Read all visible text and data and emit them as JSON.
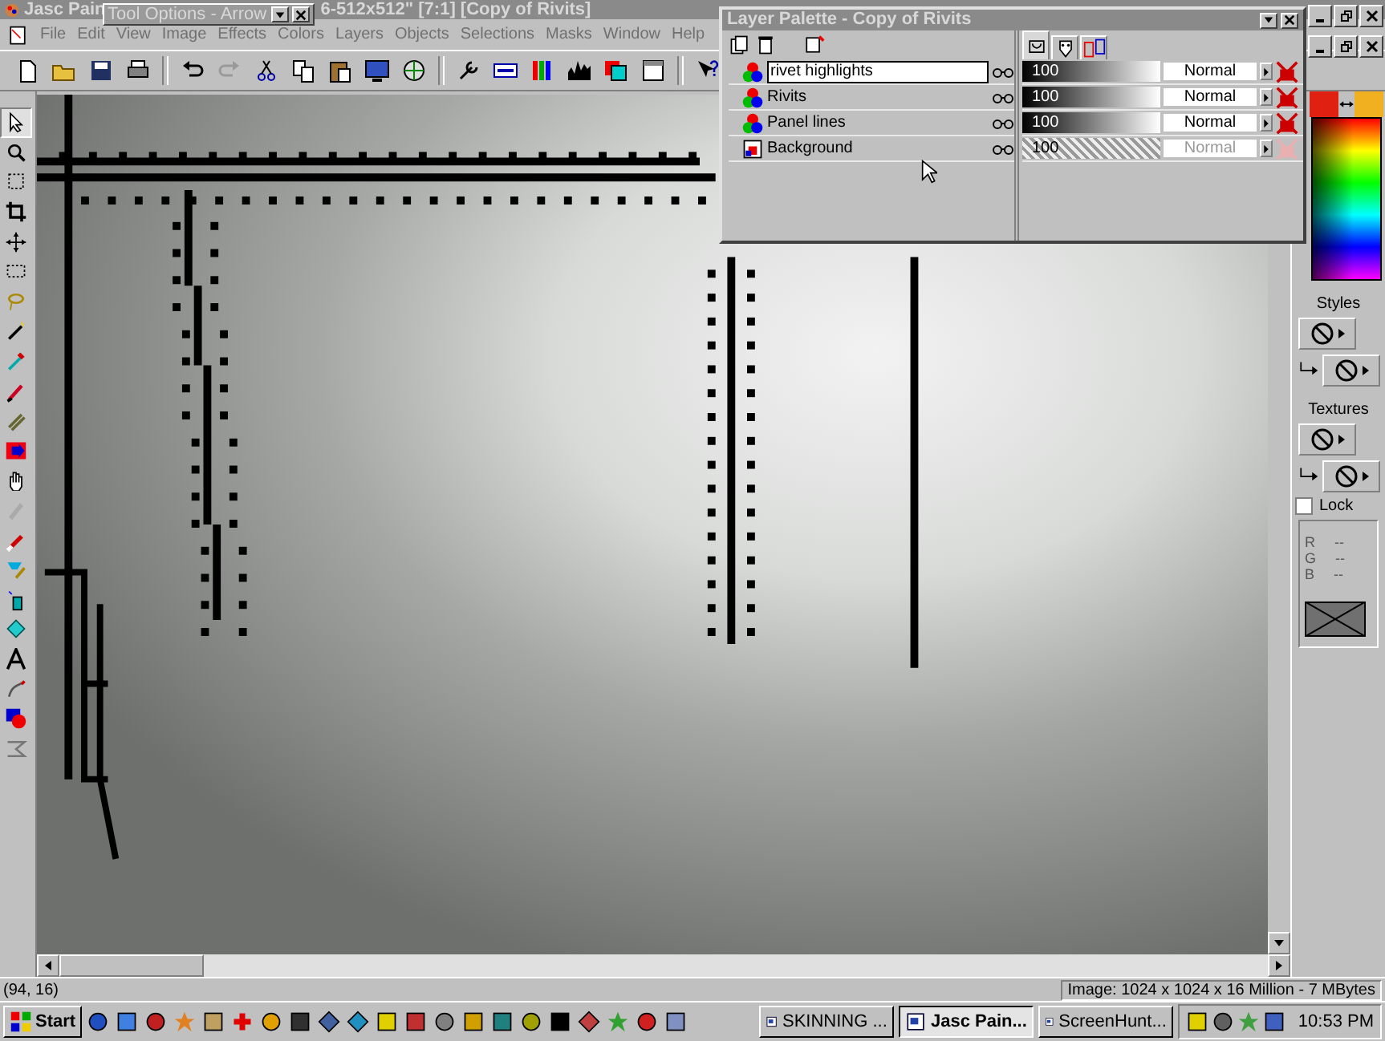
{
  "window": {
    "title_left": "Jasc Pain",
    "title_right": "6-512x512\" [7:1] [Copy of Rivits]"
  },
  "tool_options": {
    "title": "Tool Options - Arrow"
  },
  "menu": [
    "File",
    "Edit",
    "View",
    "Image",
    "Effects",
    "Colors",
    "Layers",
    "Objects",
    "Selections",
    "Masks",
    "Window",
    "Help"
  ],
  "layer_palette": {
    "title": "Layer Palette - Copy of Rivits",
    "tabs": [
      {
        "selected": true
      },
      {
        "selected": false
      },
      {
        "selected": false
      }
    ],
    "layers": [
      {
        "name": "rivet highlights",
        "selected": true,
        "disabled": false,
        "opacity": "100",
        "blend": "Normal"
      },
      {
        "name": "Rivits",
        "selected": false,
        "disabled": false,
        "opacity": "100",
        "blend": "Normal"
      },
      {
        "name": "Panel lines",
        "selected": false,
        "disabled": false,
        "opacity": "100",
        "blend": "Normal"
      },
      {
        "name": "Background",
        "selected": false,
        "disabled": true,
        "opacity": "100",
        "blend": "Normal"
      }
    ]
  },
  "color_palette": {
    "swatches": [
      {
        "color": "#e02010"
      },
      {
        "color": "#f0b020"
      }
    ],
    "styles_label": "Styles",
    "textures_label": "Textures",
    "lock": {
      "label": "Lock",
      "checked": false
    },
    "rgb": [
      {
        "label": "R",
        "value": "--"
      },
      {
        "label": "G",
        "value": "--"
      },
      {
        "label": "B",
        "value": "--"
      }
    ]
  },
  "status_bar": {
    "position": "(94, 16)",
    "image_info": "Image:  1024 x 1024 x 16 Million - 7 MBytes"
  },
  "taskbar": {
    "start": "Start",
    "tasks": [
      {
        "label": "SKINNING ...",
        "selected": false
      },
      {
        "label": "Jasc Pain...",
        "selected": true
      },
      {
        "label": "ScreenHunt...",
        "selected": false
      }
    ],
    "clock": "10:53 PM"
  }
}
